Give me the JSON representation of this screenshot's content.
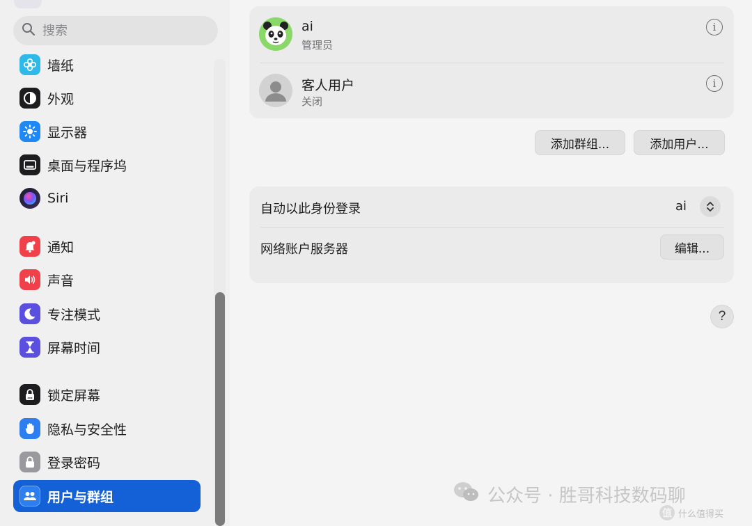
{
  "search": {
    "placeholder": "搜索"
  },
  "sidebar": {
    "items": [
      {
        "label": "墙纸",
        "icon": "wallpaper-icon",
        "color": "#2fb9e8"
      },
      {
        "label": "外观",
        "icon": "appearance-icon",
        "color": "#1d1d1f"
      },
      {
        "label": "显示器",
        "icon": "display-icon",
        "color": "#1e88f5"
      },
      {
        "label": "桌面与程序坞",
        "icon": "dock-icon",
        "color": "#1d1d1f"
      },
      {
        "label": "Siri",
        "icon": "siri-icon",
        "color": "#6a3bd8"
      },
      {
        "label": "通知",
        "icon": "notification-icon",
        "color": "#f0404a"
      },
      {
        "label": "声音",
        "icon": "sound-icon",
        "color": "#f0404a"
      },
      {
        "label": "专注模式",
        "icon": "focus-icon",
        "color": "#5b4fe0"
      },
      {
        "label": "屏幕时间",
        "icon": "screen-time-icon",
        "color": "#5b4fe0"
      },
      {
        "label": "锁定屏幕",
        "icon": "lock-screen-icon",
        "color": "#1d1d1f"
      },
      {
        "label": "隐私与安全性",
        "icon": "privacy-hand-icon",
        "color": "#2d7ef0"
      },
      {
        "label": "登录密码",
        "icon": "password-lock-icon",
        "color": "#9a9a9e"
      },
      {
        "label": "用户与群组",
        "icon": "users-groups-icon",
        "color": "#2d7ef0"
      }
    ]
  },
  "users": [
    {
      "name": "ai",
      "role": "管理员",
      "avatar": "panda-avatar"
    },
    {
      "name": "客人用户",
      "role": "关闭",
      "avatar": "guest-avatar"
    }
  ],
  "actions": {
    "add_group": "添加群组...",
    "add_user": "添加用户..."
  },
  "settings": {
    "auto_login_label": "自动以此身份登录",
    "auto_login_value": "ai",
    "network_server_label": "网络账户服务器",
    "edit_label": "编辑..."
  },
  "help": {
    "label": "?"
  },
  "watermark": {
    "text": "公众号 · 胜哥科技数码聊"
  },
  "corner_logo": {
    "badge": "值",
    "text": "什么值得买"
  },
  "colors": {
    "accent": "#1460d6",
    "info_gray": "#6e6e73"
  }
}
